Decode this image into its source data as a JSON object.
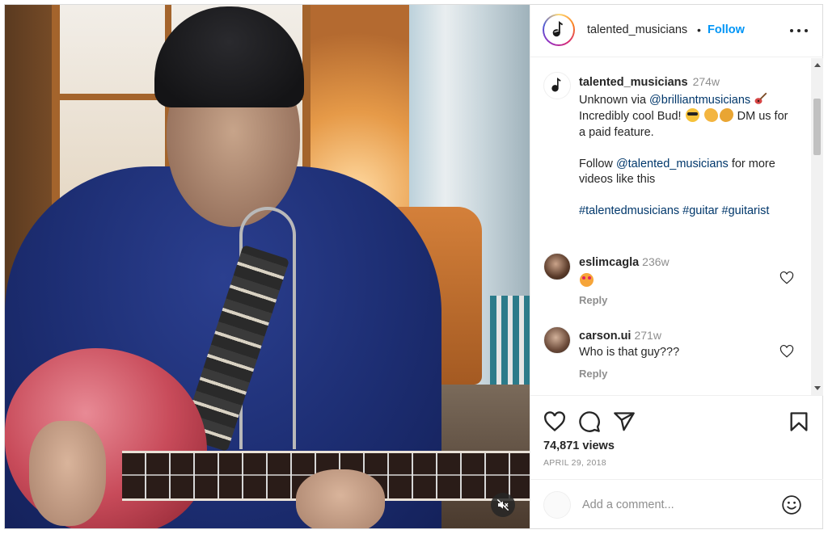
{
  "post": {
    "username": "talented_musicians",
    "follow_label": "Follow",
    "separator": "•"
  },
  "caption": {
    "username": "talented_musicians",
    "time": "274w",
    "line1_prefix": "Unknown via ",
    "mention1": "@brilliantmusicians",
    "line2": "Incredibly cool Bud!",
    "line2_suffix": "DM us for a paid feature.",
    "line3_prefix": "Follow ",
    "mention2": "@talented_musicians",
    "line3_suffix": " for more videos like this",
    "hashtags": [
      "#talentedmusicians",
      "#guitar",
      "#guitarist"
    ]
  },
  "comments": [
    {
      "username": "eslimcagla",
      "time": "236w",
      "text": "",
      "reply_label": "Reply"
    },
    {
      "username": "carson.ui",
      "time": "271w",
      "text": "Who is that guy???",
      "reply_label": "Reply"
    }
  ],
  "stats": {
    "views": "74,871 views",
    "date": "APRIL 29, 2018"
  },
  "add_comment": {
    "placeholder": "Add a comment..."
  },
  "icons": {
    "more": "more-horizontal-icon",
    "like": "heart-icon",
    "comment": "comment-bubble-icon",
    "share": "paper-plane-icon",
    "save": "bookmark-icon",
    "mute": "speaker-muted-icon",
    "emoji": "smiley-icon"
  },
  "colors": {
    "link": "#00376b",
    "follow": "#0095f6",
    "muted_text": "#8e8e8e",
    "text": "#262626"
  }
}
